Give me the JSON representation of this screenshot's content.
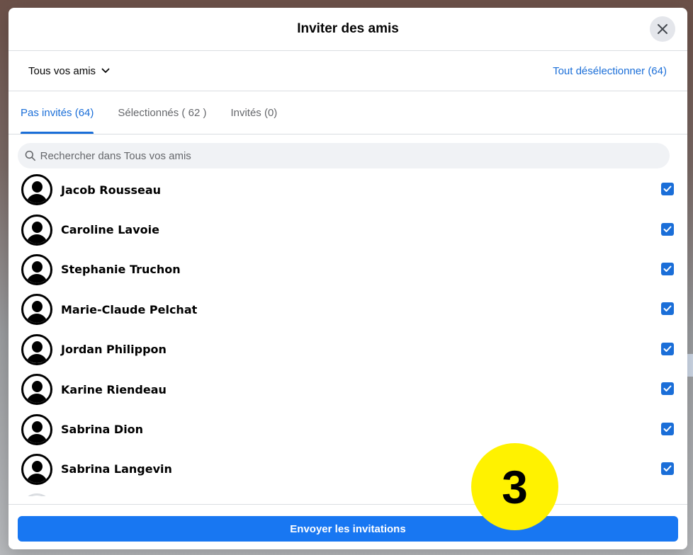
{
  "modal": {
    "title": "Inviter des amis",
    "close_icon": "close-icon"
  },
  "filter": {
    "dropdown_label": "Tous vos amis",
    "deselect_label": "Tout désélectionner (64)"
  },
  "tabs": [
    {
      "label": "Pas invités (64)",
      "active": true
    },
    {
      "label": "Sélectionnés ( 62 )",
      "active": false
    },
    {
      "label": "Invités (0)",
      "active": false
    }
  ],
  "search": {
    "placeholder": "Rechercher dans Tous vos amis"
  },
  "friends": [
    {
      "name": "Jacob Rousseau",
      "checked": true
    },
    {
      "name": "Caroline Lavoie",
      "checked": true
    },
    {
      "name": "Stephanie Truchon",
      "checked": true
    },
    {
      "name": "Marie-Claude Pelchat",
      "checked": true
    },
    {
      "name": "Jordan Philippon",
      "checked": true
    },
    {
      "name": "Karine Riendeau",
      "checked": true
    },
    {
      "name": "Sabrina Dion",
      "checked": true
    },
    {
      "name": "Sabrina Langevin",
      "checked": true
    },
    {
      "name": "",
      "checked": true
    }
  ],
  "footer": {
    "send_label": "Envoyer les invitations"
  },
  "annotation": {
    "step_number": "3",
    "color": "#fff200"
  },
  "colors": {
    "accent": "#1877f2",
    "link": "#1a6ed8"
  }
}
